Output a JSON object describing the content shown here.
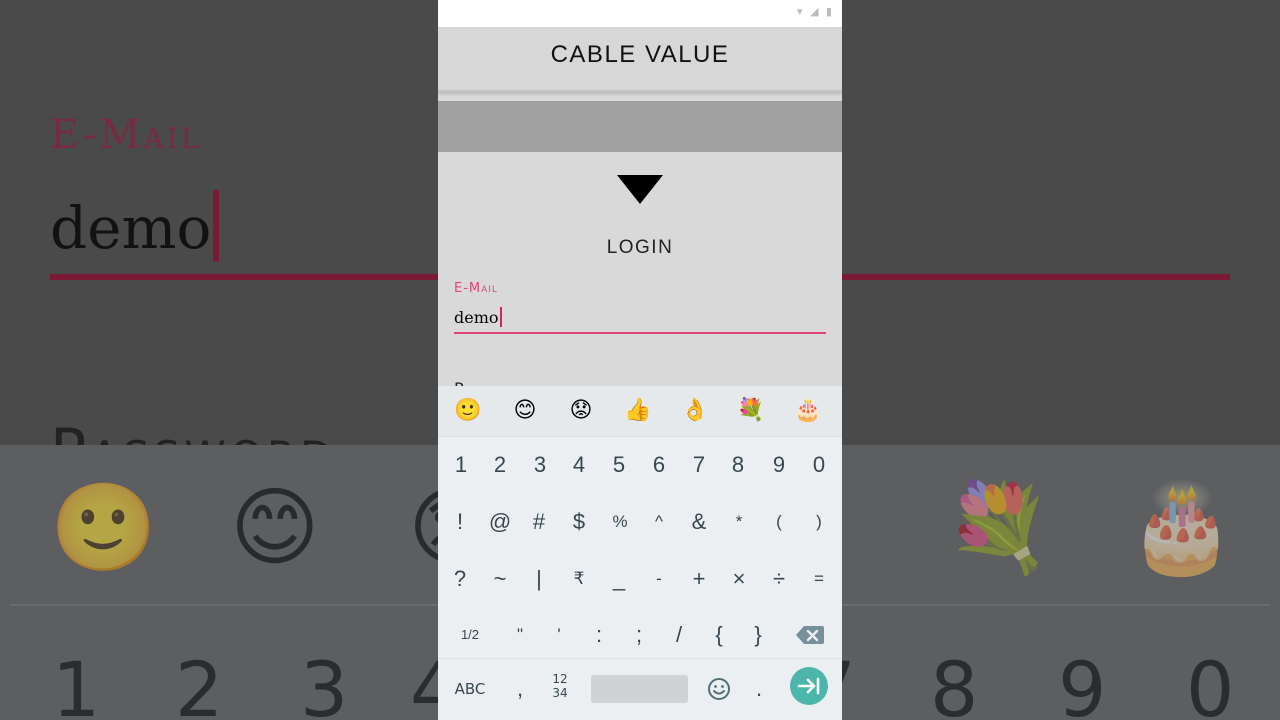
{
  "background": {
    "email_label": "E-Mail",
    "email_value": "demo",
    "password_label": "Password",
    "emojis": [
      "🙂",
      "😊",
      "😟",
      "💐",
      "🎂"
    ],
    "digits": [
      "1",
      "2",
      "3",
      "4",
      "7",
      "8",
      "9",
      "0"
    ]
  },
  "app": {
    "title": "CABLE VALUE",
    "login_heading": "LOGIN",
    "email_label": "E-Mail",
    "email_value": "demo",
    "password_label": "Password"
  },
  "keyboard": {
    "emoji_suggestions": [
      "🙂",
      "😊",
      "😟",
      "👍",
      "👌",
      "💐",
      "🎂"
    ],
    "row1": [
      "1",
      "2",
      "3",
      "4",
      "5",
      "6",
      "7",
      "8",
      "9",
      "0"
    ],
    "row2": [
      "!",
      "@",
      "#",
      "$",
      "%",
      "^",
      "&",
      "*",
      "(",
      ")"
    ],
    "row3": [
      "?",
      "~",
      "|",
      "₹",
      "_",
      "-",
      "+",
      "×",
      "÷",
      "="
    ],
    "row4": [
      "1/2",
      "\"",
      "'",
      ":",
      ";",
      "/",
      "{",
      "}"
    ],
    "abc_label": "ABC",
    "comma": ",",
    "numeric_label_top": "12",
    "numeric_label_bottom": "34",
    "period": ".",
    "colors": {
      "accent": "#4db6ac",
      "key_text": "#37474f",
      "field_accent": "#e0457a"
    }
  }
}
